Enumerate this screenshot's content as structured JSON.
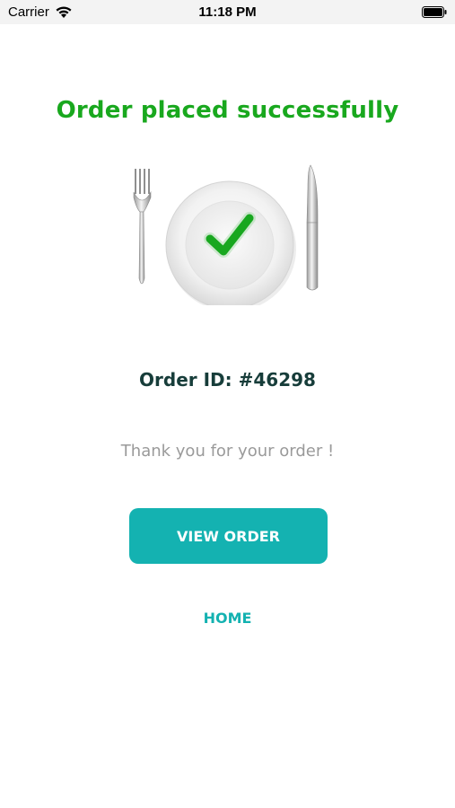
{
  "status_bar": {
    "carrier": "Carrier",
    "time": "11:18 PM",
    "wifi_icon": "wifi-icon",
    "battery_icon": "battery-icon"
  },
  "confirmation": {
    "title": "Order placed successfully",
    "illustration_icon": "plate-checkmark-icon",
    "order_id": "Order ID: #46298",
    "message": "Thank you for your order !"
  },
  "actions": {
    "view_order_label": "VIEW ORDER",
    "home_label": "HOME"
  },
  "colors": {
    "title_green": "#19a81e",
    "accent_teal": "#14b2b1",
    "order_id_text": "#173d3a",
    "muted_text": "#9a9a9a",
    "status_bar_bg": "#f3f3f3"
  }
}
